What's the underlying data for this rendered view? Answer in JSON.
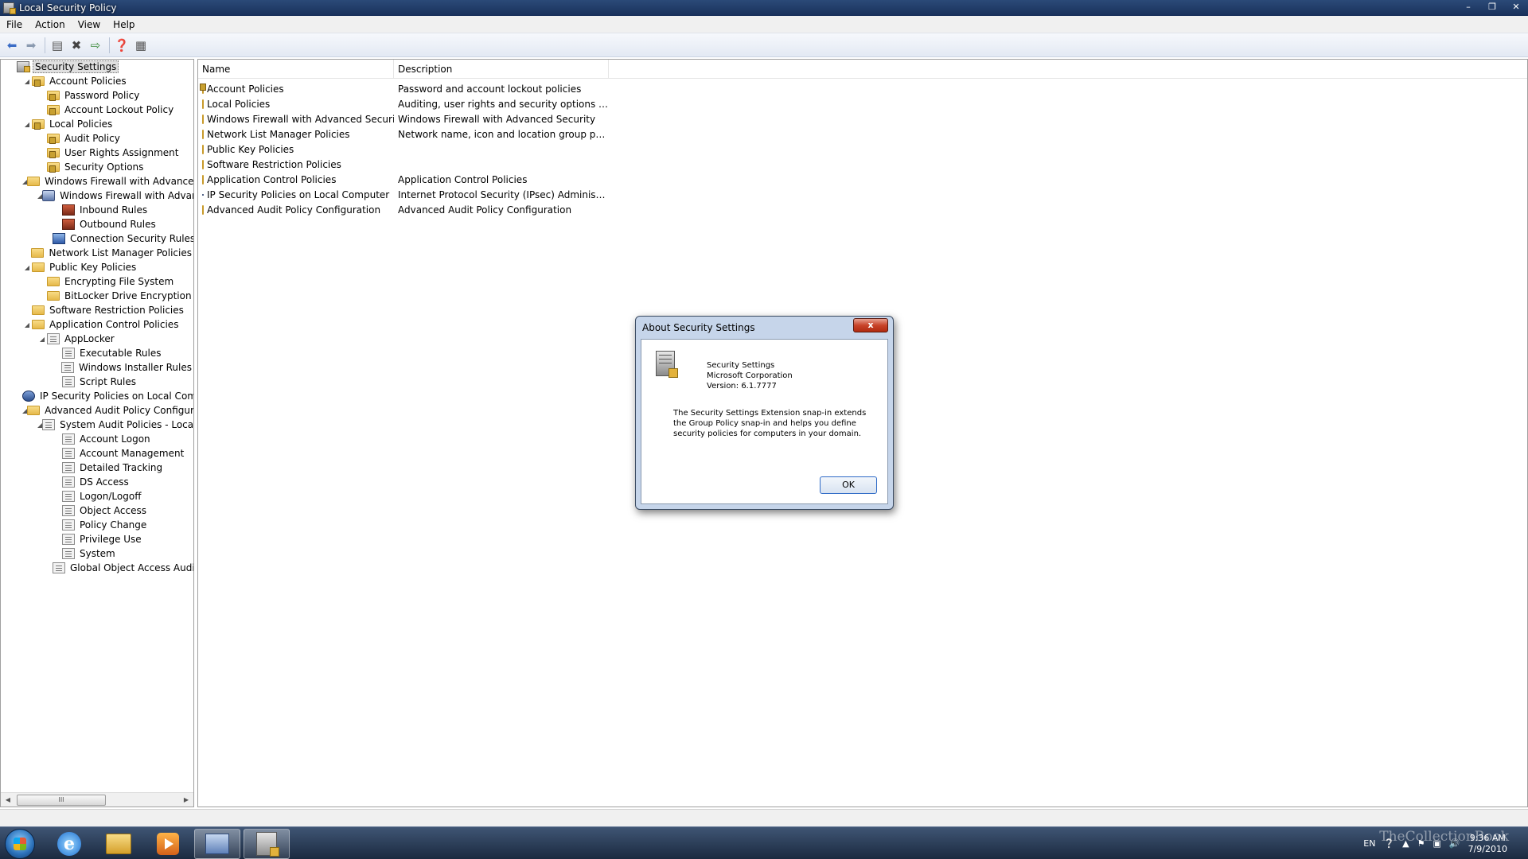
{
  "window": {
    "title": "Local Security Policy",
    "buttons": [
      "–",
      "❐",
      "✕"
    ]
  },
  "menu": [
    "File",
    "Action",
    "View",
    "Help"
  ],
  "toolbar": {
    "icons": [
      "back-arrow-icon",
      "forward-arrow-icon",
      "show-hide-tree-icon",
      "delete-icon",
      "export-list-icon",
      "help-icon",
      "properties-icon"
    ]
  },
  "tree": [
    {
      "label": "Security Settings",
      "depth": 0,
      "exp": "",
      "icon": "security",
      "selected": true
    },
    {
      "label": "Account Policies",
      "depth": 1,
      "exp": "◢",
      "icon": "folder-lock"
    },
    {
      "label": "Password Policy",
      "depth": 2,
      "exp": "",
      "icon": "folder-lock"
    },
    {
      "label": "Account Lockout Policy",
      "depth": 2,
      "exp": "",
      "icon": "folder-lock"
    },
    {
      "label": "Local Policies",
      "depth": 1,
      "exp": "◢",
      "icon": "folder-lock"
    },
    {
      "label": "Audit Policy",
      "depth": 2,
      "exp": "",
      "icon": "folder-lock"
    },
    {
      "label": "User Rights Assignment",
      "depth": 2,
      "exp": "",
      "icon": "folder-lock"
    },
    {
      "label": "Security Options",
      "depth": 2,
      "exp": "",
      "icon": "folder-lock"
    },
    {
      "label": "Windows Firewall with Advanced Secu",
      "depth": 1,
      "exp": "◢",
      "icon": "folder"
    },
    {
      "label": "Windows Firewall with Advanced",
      "depth": 2,
      "exp": "◢",
      "icon": "shield"
    },
    {
      "label": "Inbound Rules",
      "depth": 3,
      "exp": "",
      "icon": "fw"
    },
    {
      "label": "Outbound Rules",
      "depth": 3,
      "exp": "",
      "icon": "fw"
    },
    {
      "label": "Connection Security Rules",
      "depth": 3,
      "exp": "",
      "icon": "conn"
    },
    {
      "label": "Network List Manager Policies",
      "depth": 1,
      "exp": "",
      "icon": "folder"
    },
    {
      "label": "Public Key Policies",
      "depth": 1,
      "exp": "◢",
      "icon": "folder"
    },
    {
      "label": "Encrypting File System",
      "depth": 2,
      "exp": "",
      "icon": "folder"
    },
    {
      "label": "BitLocker Drive Encryption",
      "depth": 2,
      "exp": "",
      "icon": "folder"
    },
    {
      "label": "Software Restriction Policies",
      "depth": 1,
      "exp": "",
      "icon": "folder"
    },
    {
      "label": "Application Control Policies",
      "depth": 1,
      "exp": "◢",
      "icon": "folder"
    },
    {
      "label": "AppLocker",
      "depth": 2,
      "exp": "◢",
      "icon": "doc"
    },
    {
      "label": "Executable Rules",
      "depth": 3,
      "exp": "",
      "icon": "doc"
    },
    {
      "label": "Windows Installer Rules",
      "depth": 3,
      "exp": "",
      "icon": "doc"
    },
    {
      "label": "Script Rules",
      "depth": 3,
      "exp": "",
      "icon": "doc"
    },
    {
      "label": "IP Security Policies on Local Compute",
      "depth": 1,
      "exp": "",
      "icon": "ipsec"
    },
    {
      "label": "Advanced Audit Policy Configuration",
      "depth": 1,
      "exp": "◢",
      "icon": "folder"
    },
    {
      "label": "System Audit Policies - Local Grou",
      "depth": 2,
      "exp": "◢",
      "icon": "doc"
    },
    {
      "label": "Account Logon",
      "depth": 3,
      "exp": "",
      "icon": "doc"
    },
    {
      "label": "Account Management",
      "depth": 3,
      "exp": "",
      "icon": "doc"
    },
    {
      "label": "Detailed Tracking",
      "depth": 3,
      "exp": "",
      "icon": "doc"
    },
    {
      "label": "DS Access",
      "depth": 3,
      "exp": "",
      "icon": "doc"
    },
    {
      "label": "Logon/Logoff",
      "depth": 3,
      "exp": "",
      "icon": "doc"
    },
    {
      "label": "Object Access",
      "depth": 3,
      "exp": "",
      "icon": "doc"
    },
    {
      "label": "Policy Change",
      "depth": 3,
      "exp": "",
      "icon": "doc"
    },
    {
      "label": "Privilege Use",
      "depth": 3,
      "exp": "",
      "icon": "doc"
    },
    {
      "label": "System",
      "depth": 3,
      "exp": "",
      "icon": "doc"
    },
    {
      "label": "Global Object Access Auditing",
      "depth": 3,
      "exp": "",
      "icon": "doc"
    }
  ],
  "list": {
    "columns": [
      "Name",
      "Description"
    ],
    "rows": [
      {
        "name": "Account Policies",
        "desc": "Password and account lockout policies",
        "icon": "folder-lock"
      },
      {
        "name": "Local Policies",
        "desc": "Auditing, user rights and security options polici...",
        "icon": "folder-lock"
      },
      {
        "name": "Windows Firewall with Advanced Security",
        "desc": "Windows Firewall with Advanced Security",
        "icon": "folder"
      },
      {
        "name": "Network List Manager Policies",
        "desc": "Network name, icon and location group policies.",
        "icon": "folder"
      },
      {
        "name": "Public Key Policies",
        "desc": "",
        "icon": "folder"
      },
      {
        "name": "Software Restriction Policies",
        "desc": "",
        "icon": "folder"
      },
      {
        "name": "Application Control Policies",
        "desc": "Application Control Policies",
        "icon": "folder"
      },
      {
        "name": "IP Security Policies on Local Computer",
        "desc": "Internet Protocol Security (IPsec) Administratio...",
        "icon": "ipsec"
      },
      {
        "name": "Advanced Audit Policy Configuration",
        "desc": "Advanced Audit Policy Configuration",
        "icon": "folder"
      }
    ]
  },
  "dialog": {
    "title": "About Security Settings",
    "close": "x",
    "product": "Security Settings",
    "company": "Microsoft Corporation",
    "version": "Version: 6.1.7777",
    "description": "The Security Settings Extension snap-in extends the Group Policy snap-in and helps you define security policies for computers in your domain.",
    "ok": "OK"
  },
  "scrollbar": {
    "thumb": "III"
  },
  "taskbar": {
    "apps": [
      "internet-explorer",
      "windows-explorer",
      "media-player",
      "mmc",
      "local-security-policy"
    ],
    "tray": {
      "lang": "EN",
      "time": "9:36 AM",
      "date": "7/9/2010"
    },
    "watermark": "TheCollectionBook"
  }
}
